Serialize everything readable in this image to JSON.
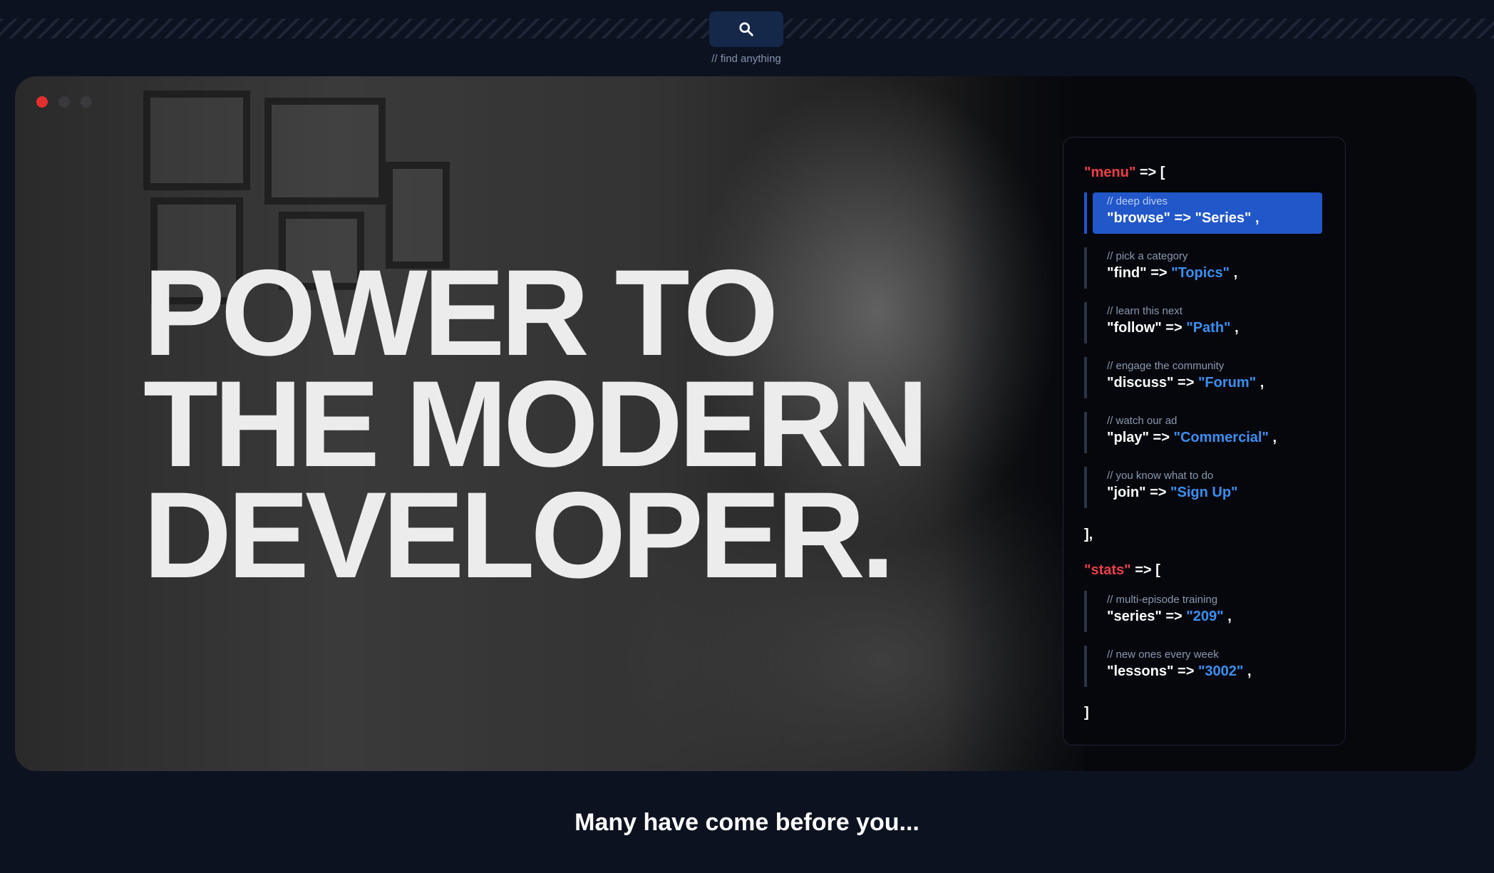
{
  "search": {
    "icon": "search-icon",
    "hint": "// find anything"
  },
  "window": {
    "dots": [
      "close",
      "minimize",
      "maximize"
    ],
    "dot_colors": [
      "#e3302f",
      "#3a3a3e",
      "#3a3a3e"
    ]
  },
  "hero": {
    "headline": [
      "POWER TO",
      "THE MODERN",
      "DEVELOPER."
    ]
  },
  "panel": {
    "menu_key": "\"menu\"",
    "menu_open": "=> [",
    "menu_items": [
      {
        "comment": "// deep dives",
        "key": "\"browse\"",
        "arrow": "=>",
        "value": "\"Series\"",
        "sep": ",",
        "active": true
      },
      {
        "comment": "// pick a category",
        "key": "\"find\"",
        "arrow": "=>",
        "value": "\"Topics\"",
        "sep": ","
      },
      {
        "comment": "// learn this next",
        "key": "\"follow\"",
        "arrow": "=>",
        "value": "\"Path\"",
        "sep": ","
      },
      {
        "comment": "// engage the community",
        "key": "\"discuss\"",
        "arrow": "=>",
        "value": "\"Forum\"",
        "sep": ","
      },
      {
        "comment": "// watch our ad",
        "key": "\"play\"",
        "arrow": "=>",
        "value": "\"Commercial\"",
        "sep": ","
      },
      {
        "comment": "// you know what to do",
        "key": "\"join\"",
        "arrow": "=>",
        "value": "\"Sign Up\"",
        "sep": ""
      }
    ],
    "menu_close": "],",
    "stats_key": "\"stats\"",
    "stats_open": "=> [",
    "stats_items": [
      {
        "comment": "// multi-episode training",
        "key": "\"series\"",
        "arrow": "=>",
        "value": "\"209\"",
        "sep": ","
      },
      {
        "comment": "// new ones every week",
        "key": "\"lessons\"",
        "arrow": "=>",
        "value": "\"3002\"",
        "sep": ","
      }
    ],
    "stats_close": "]"
  },
  "tagline": "Many have come before you..."
}
